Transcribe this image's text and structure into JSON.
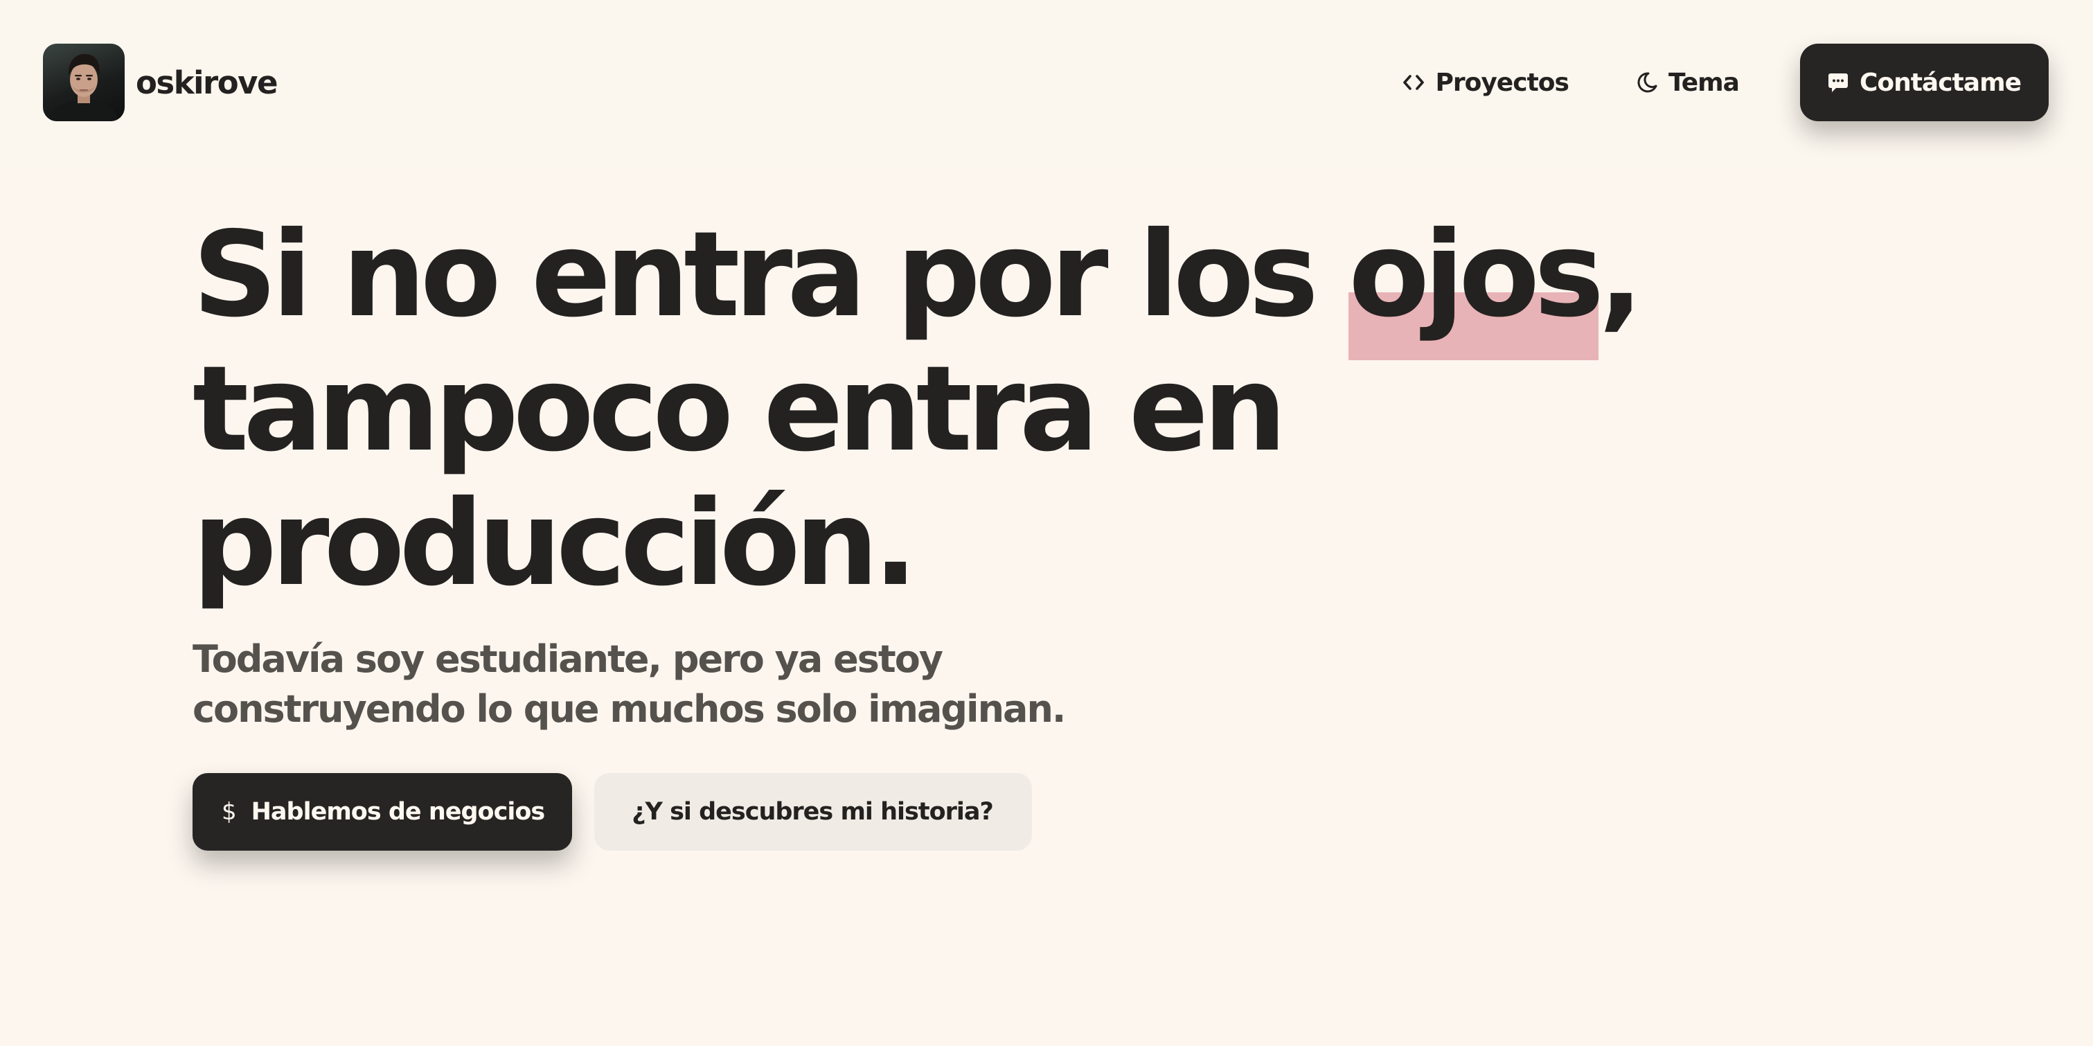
{
  "header": {
    "brand_name": "oskirove",
    "nav": {
      "projects_label": "Proyectos",
      "theme_label": "Tema",
      "contact_label": "Contáctame"
    }
  },
  "hero": {
    "headline": {
      "before_highlight": "Si no entra por los ",
      "highlight": "ojos",
      "after_highlight": ",",
      "line2": "tampoco entra en",
      "line3": "producción."
    },
    "subtitle": "Todavía soy estudiante, pero ya estoy construyendo lo que muchos solo imaginan.",
    "primary_button": {
      "icon_glyph": "$",
      "label": "Hablemos de negocios"
    },
    "secondary_button": {
      "label": "¿Y si descubres mi historia?"
    }
  },
  "icons": {
    "projects": "code-icon",
    "theme": "moon-icon",
    "contact": "chat-bubble-icon",
    "primary_button": "dollar-icon"
  },
  "colors": {
    "background": "#fcf6ef",
    "text": "#242220",
    "subtitle_text": "#55514d",
    "dark_button": "#262523",
    "light_button": "#f0ebe4",
    "highlight": "#e8b3b6"
  }
}
